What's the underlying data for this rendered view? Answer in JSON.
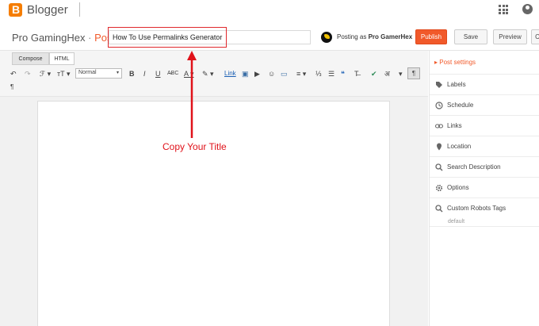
{
  "app": {
    "brand": "Blogger"
  },
  "header": {
    "blog_name": "Pro GamingHex",
    "separator": "·",
    "section": "Post",
    "title_value": "How To Use Permalinks Generator",
    "posting_as_prefix": "Posting as",
    "posting_as_name": "Pro GamerHex",
    "publish_label": "Publish",
    "save_label": "Save",
    "preview_label": "Preview",
    "close_label": "C"
  },
  "toolbar": {
    "compose_label": "Compose",
    "html_label": "HTML",
    "undo": "↶",
    "redo": "↷",
    "font_family": "ℱ ▾",
    "font_size": "ᴛT ▾",
    "format_value": "Normal",
    "bold": "B",
    "italic": "I",
    "underline": "U",
    "strike": "A̶BC",
    "text_color": "A ▾",
    "highlight": "✎ ▾",
    "link": "Link",
    "image": "▣",
    "video": "▶",
    "emoji": "☺",
    "jump_break": "▭",
    "align": "≡ ▾",
    "numbered_list": "⅓",
    "bullet_list": "☰",
    "quote": "❝",
    "clear_format": "T̶",
    "spellcheck": "✔",
    "input_tools": "अ",
    "input_dropdown": "▾",
    "rtl": "¶",
    "ltr": "¶",
    "ltr_marker": "◂"
  },
  "annotation": {
    "text": "Copy Your Title",
    "color": "#e0121a"
  },
  "sidebar": {
    "heading": "▸ Post settings",
    "items": [
      {
        "label": "Labels",
        "icon": "tag-icon"
      },
      {
        "label": "Schedule",
        "icon": "clock-icon"
      },
      {
        "label": "Links",
        "icon": "link-icon"
      },
      {
        "label": "Location",
        "icon": "pin-icon"
      },
      {
        "label": "Search Description",
        "icon": "search-icon"
      },
      {
        "label": "Options",
        "icon": "gear-icon"
      },
      {
        "label": "Custom Robots Tags",
        "icon": "search-icon"
      }
    ],
    "robots_value": "default"
  },
  "colors": {
    "accent": "#f1592a",
    "brand": "#f57d00",
    "annotation": "#e0121a"
  }
}
